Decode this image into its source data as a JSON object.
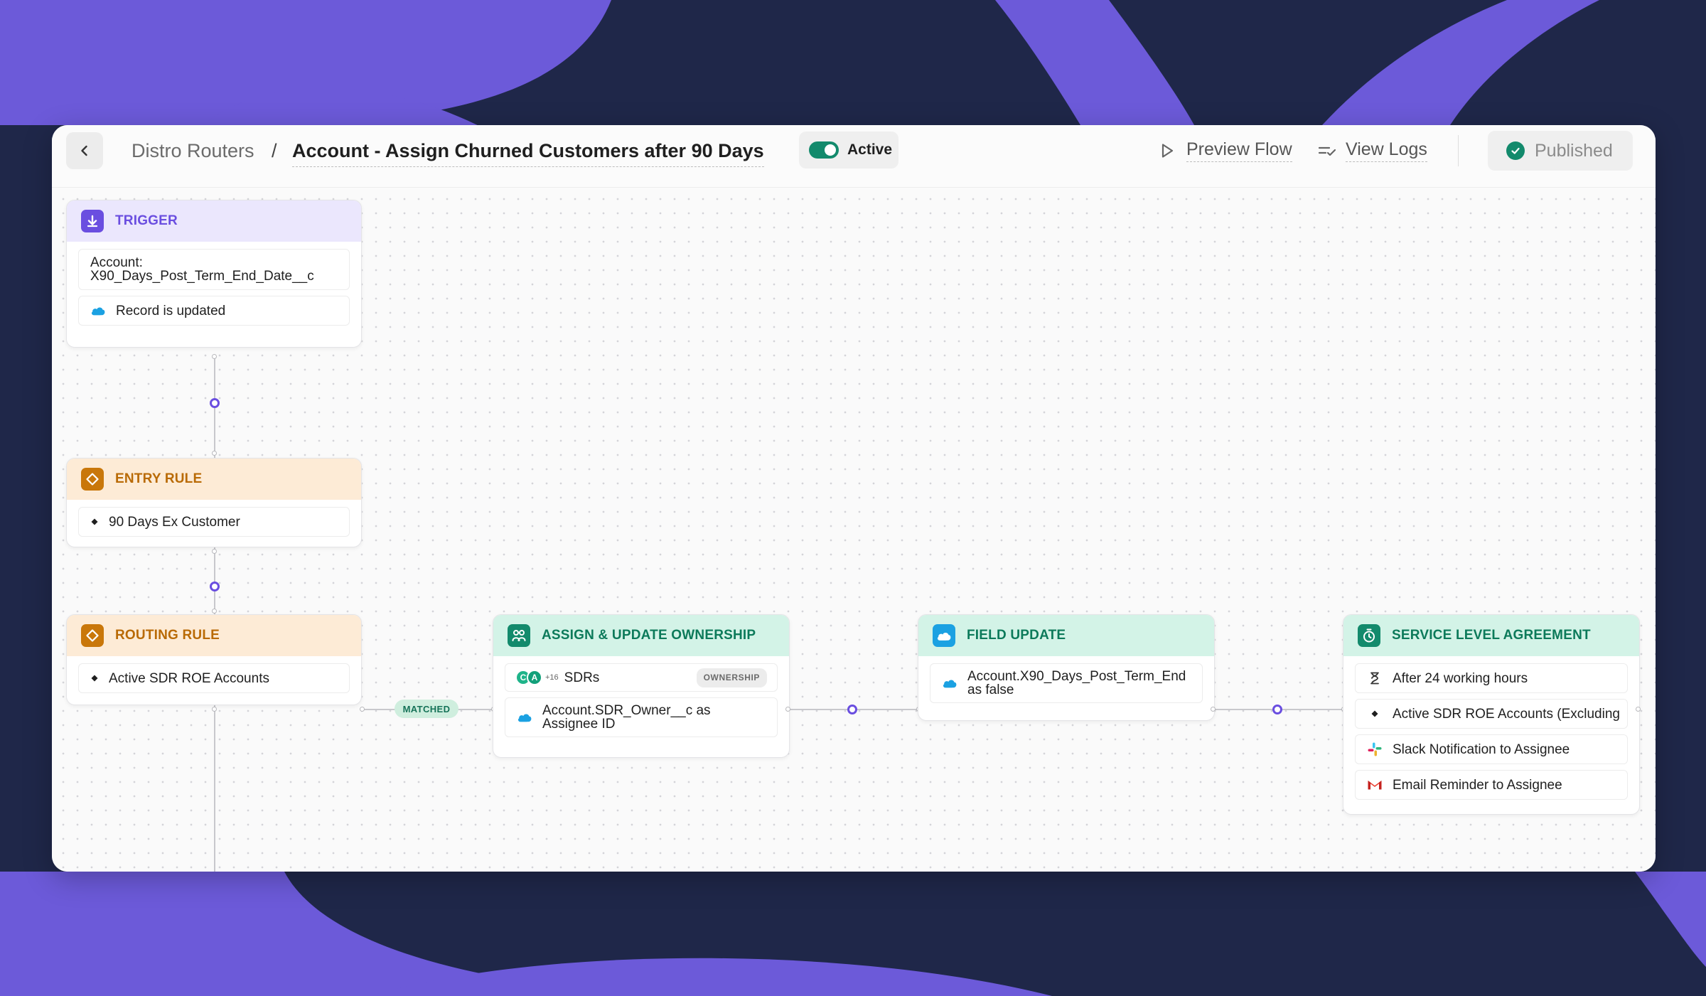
{
  "header": {
    "breadcrumb_parent": "Distro Routers",
    "breadcrumb_separator": "/",
    "flow_title": "Account - Assign Churned Customers after 90 Days",
    "active_label": "Active",
    "preview_label": "Preview Flow",
    "logs_label": "View Logs",
    "published_label": "Published"
  },
  "nodes": {
    "trigger": {
      "title": "TRIGGER",
      "field_line1": "Account:",
      "field_line2": "X90_Days_Post_Term_End_Date__c",
      "event": "Record is updated"
    },
    "entry_rule": {
      "title": "ENTRY RULE",
      "rule": "90 Days Ex Customer"
    },
    "routing_rule": {
      "title": "ROUTING RULE",
      "rule": "Active SDR ROE Accounts"
    },
    "matched_label": "MATCHED",
    "assign": {
      "title": "ASSIGN & UPDATE OWNERSHIP",
      "avatar_1": "C",
      "avatar_2": "A",
      "more_count": "+16",
      "team": "SDRs",
      "badge": "OWNERSHIP",
      "field_line1": "Account.SDR_Owner__c as",
      "field_line2": "Assignee ID"
    },
    "field_update": {
      "title": "FIELD UPDATE",
      "line1": "Account.X90_Days_Post_Term_End",
      "line2": "as false"
    },
    "sla": {
      "title": "SERVICE LEVEL AGREEMENT",
      "items": [
        "After 24 working hours",
        "Active SDR ROE Accounts (Excluding",
        "Slack Notification to Assignee",
        "Email Reminder to Assignee"
      ]
    }
  },
  "colors": {
    "background": "#1f2749",
    "swoosh": "#6c5ad9",
    "trigger_accent": "#6a4ee0",
    "rule_accent": "#c9770a",
    "action_accent": "#138a6c",
    "salesforce_blue": "#1ba1e2"
  }
}
